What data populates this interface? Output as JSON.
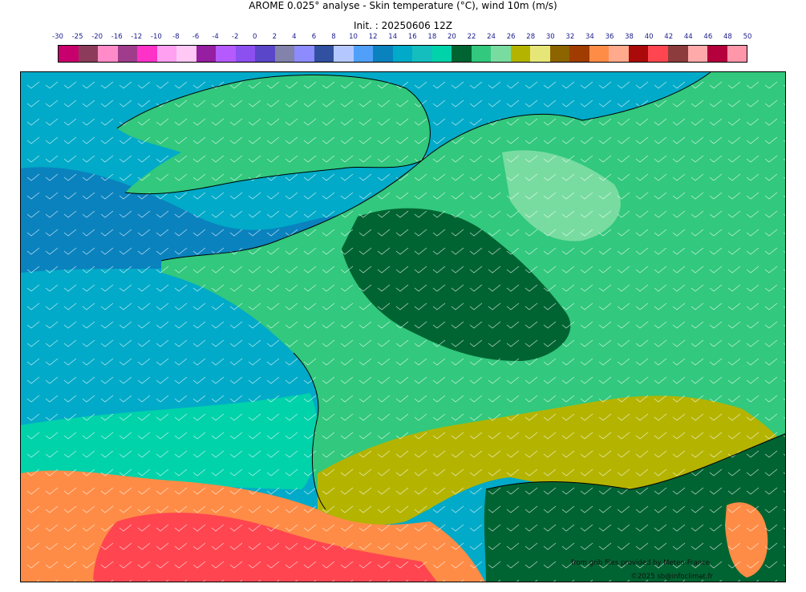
{
  "header": {
    "title": "AROME 0.025° analyse - Skin temperature (°C), wind 10m (m/s)",
    "init": "Init. : 20250606 12Z"
  },
  "legend": {
    "labels": [
      "-30",
      "-25",
      "-20",
      "-16",
      "-12",
      "-10",
      "-8",
      "-6",
      "-4",
      "-2",
      "0",
      "2",
      "4",
      "6",
      "8",
      "10",
      "12",
      "14",
      "16",
      "18",
      "20",
      "22",
      "24",
      "26",
      "28",
      "30",
      "32",
      "34",
      "36",
      "38",
      "40",
      "42",
      "44",
      "46",
      "48",
      "50"
    ],
    "colors": [
      "#c8006e",
      "#8c3c5a",
      "#ff8cc8",
      "#a03c8c",
      "#ff32c8",
      "#ffa0f0",
      "#ffc8f5",
      "#961ea0",
      "#b45aff",
      "#8c50f0",
      "#5a46c8",
      "#8282aa",
      "#8c8cff",
      "#3250a0",
      "#b4c8ff",
      "#50a0fa",
      "#0a82be",
      "#00aac8",
      "#14bebe",
      "#00d2aa",
      "#006432",
      "#32c87d",
      "#78dca0",
      "#b4b400",
      "#e6e678",
      "#8c6400",
      "#a03c00",
      "#ff8c46",
      "#ffaa8c",
      "#aa0a0a",
      "#ff4650",
      "#8c3c3c",
      "#ffaaaa",
      "#b4003c",
      "#ff96aa"
    ]
  },
  "map": {
    "region": "France and surrounding areas",
    "palette": {
      "sea": "#00aac8",
      "sea_warm": "#00d2aa",
      "land_green": "#32c87d",
      "land_dark": "#006432",
      "land_light": "#78dca0",
      "hot_yellow": "#b4b400",
      "hot_orange": "#ff8c46",
      "hot_red": "#ff4650",
      "sea_cool": "#0a82be",
      "mediterranean": "#006432"
    }
  },
  "credits": {
    "line1": "from grib files provided by Meteo-France",
    "line2": "©2025 sb@infoclimat.fr"
  }
}
